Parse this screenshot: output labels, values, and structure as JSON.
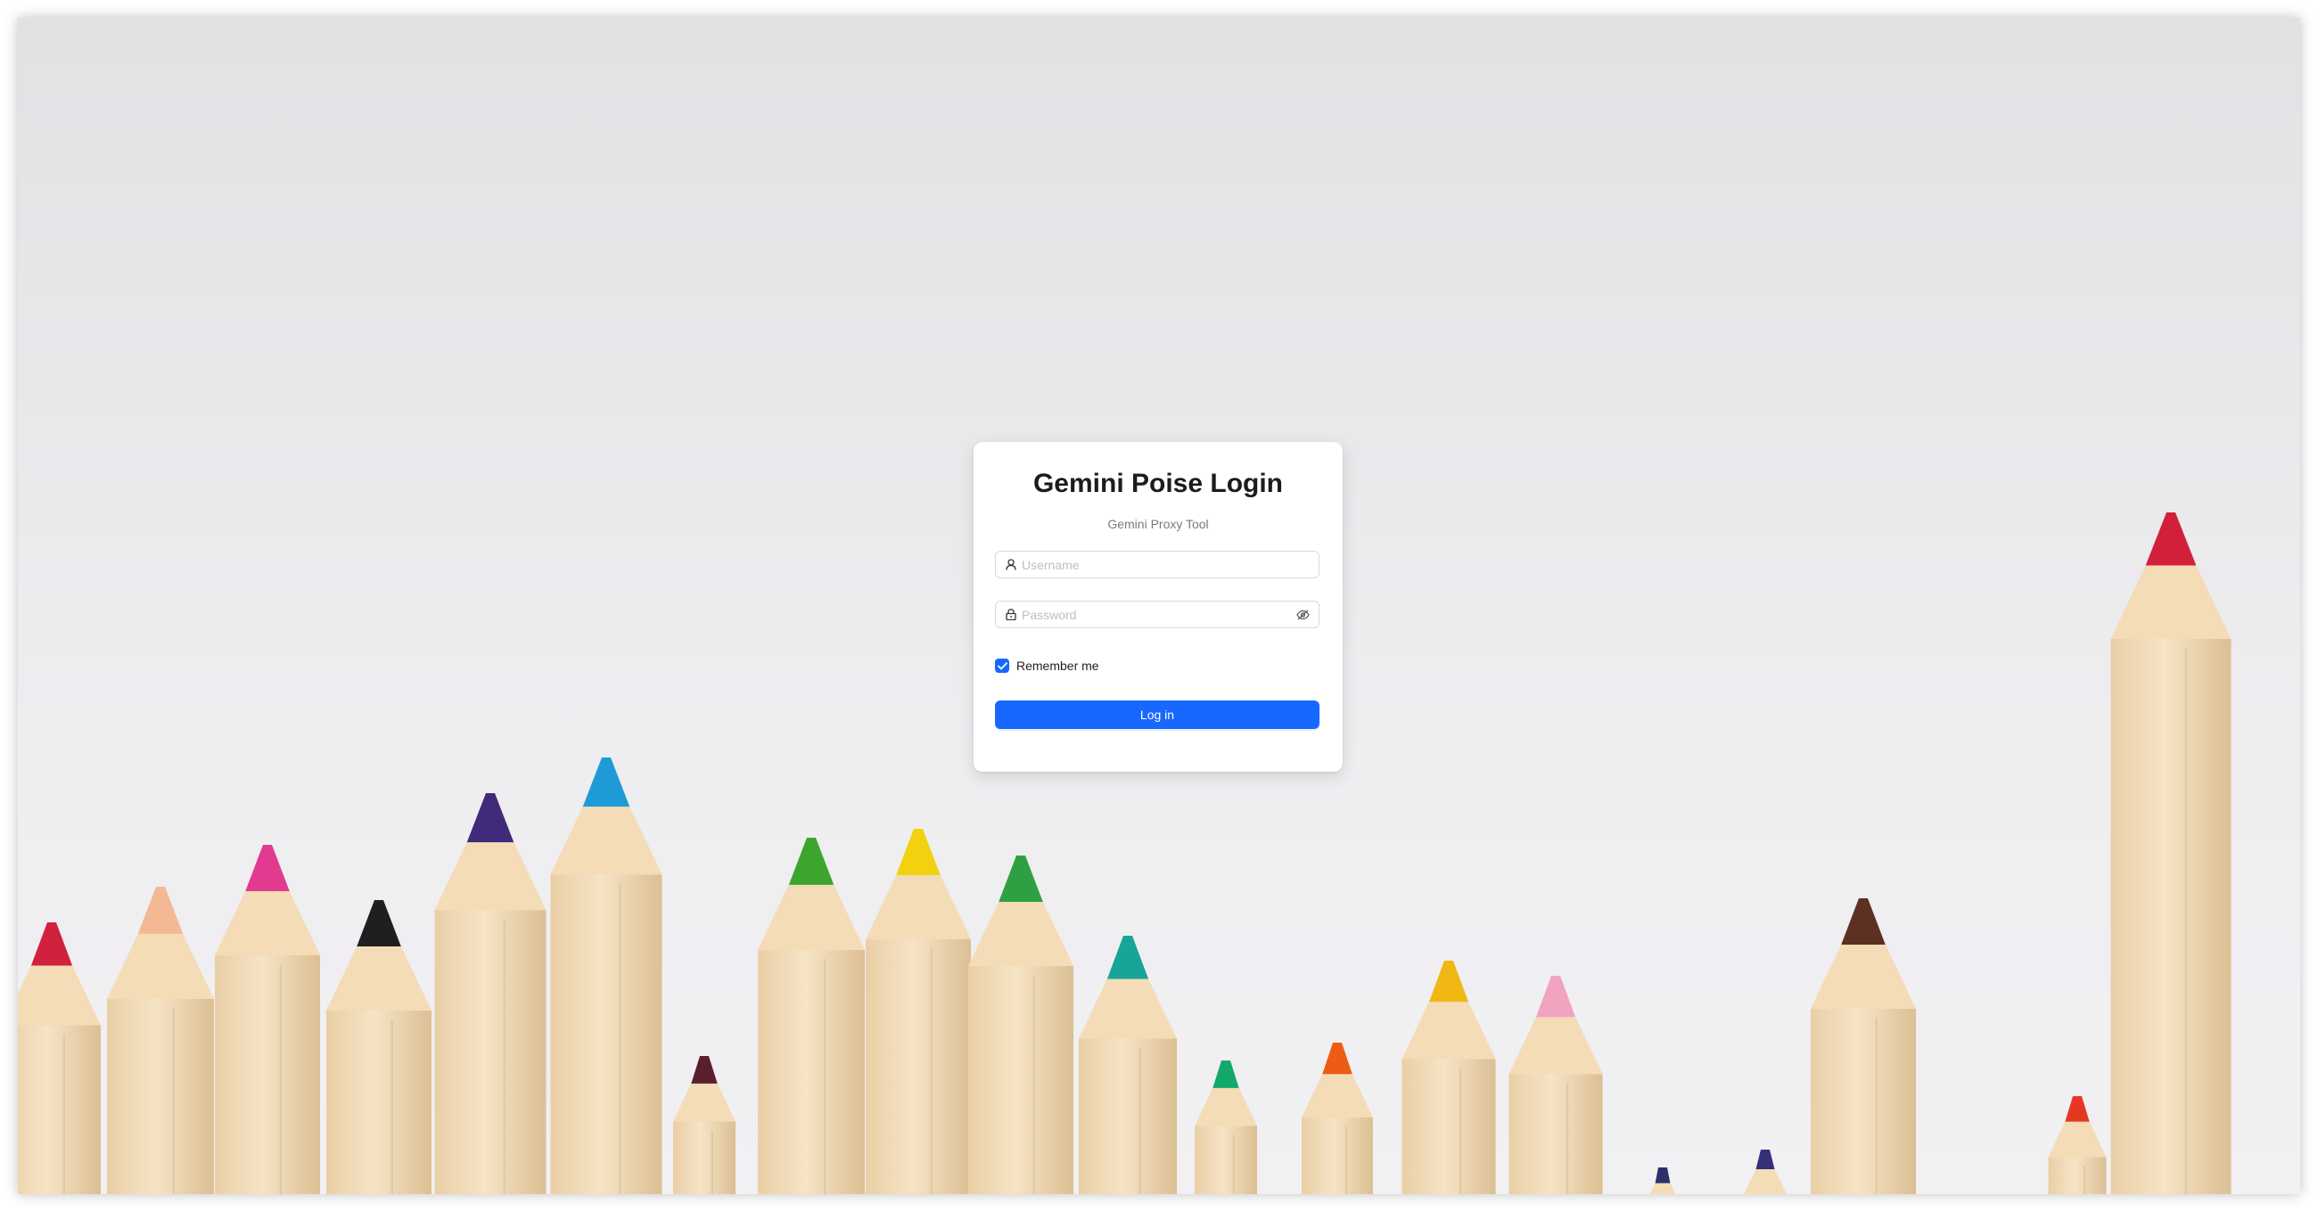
{
  "login": {
    "title": "Gemini Poise Login",
    "subtitle": "Gemini Proxy Tool",
    "username": {
      "placeholder": "Username",
      "value": "",
      "icon": "user-icon"
    },
    "password": {
      "placeholder": "Password",
      "value": "",
      "icon": "lock-icon",
      "toggle_icon": "eye-invisible-icon"
    },
    "remember_me": {
      "label": "Remember me",
      "checked": true
    },
    "submit_label": "Log in"
  },
  "colors": {
    "primary": "#1668ff",
    "card_background": "#ffffff",
    "page_background": "#e9e8eb"
  },
  "background": {
    "description_icon": "colored-pencils-photo"
  }
}
